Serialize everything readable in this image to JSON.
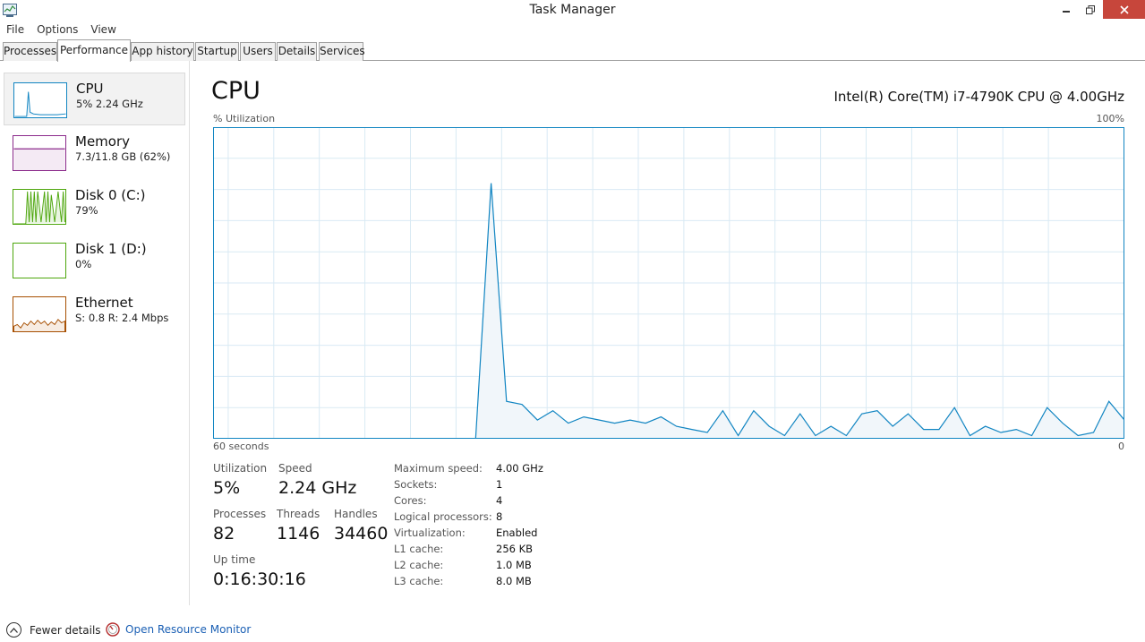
{
  "window": {
    "title": "Task Manager"
  },
  "menu": [
    "File",
    "Options",
    "View"
  ],
  "tabs": [
    "Processes",
    "Performance",
    "App history",
    "Startup",
    "Users",
    "Details",
    "Services"
  ],
  "sidebar": [
    {
      "name": "CPU",
      "sub": "5%  2.24 GHz",
      "color": "#1185c2"
    },
    {
      "name": "Memory",
      "sub": "7.3/11.8 GB (62%)",
      "color": "#8b2a8b"
    },
    {
      "name": "Disk 0 (C:)",
      "sub": "79%",
      "color": "#4da60c"
    },
    {
      "name": "Disk 1 (D:)",
      "sub": "0%",
      "color": "#4da60c"
    },
    {
      "name": "Ethernet",
      "sub": "S: 0.8  R: 2.4 Mbps",
      "color": "#a74f01"
    }
  ],
  "main": {
    "title": "CPU",
    "model": "Intel(R) Core(TM) i7-4790K CPU @ 4.00GHz",
    "graph_label": "% Utilization",
    "graph_max": "100%",
    "axis_left": "60 seconds",
    "axis_right": "0"
  },
  "stats": {
    "utilization_label": "Utilization",
    "utilization": "5%",
    "speed_label": "Speed",
    "speed": "2.24 GHz",
    "processes_label": "Processes",
    "processes": "82",
    "threads_label": "Threads",
    "threads": "1146",
    "handles_label": "Handles",
    "handles": "34460",
    "uptime_label": "Up time",
    "uptime": "0:16:30:16"
  },
  "specs": [
    {
      "label": "Maximum speed:",
      "value": "4.00 GHz"
    },
    {
      "label": "Sockets:",
      "value": "1"
    },
    {
      "label": "Cores:",
      "value": "4"
    },
    {
      "label": "Logical processors:",
      "value": "8"
    },
    {
      "label": "Virtualization:",
      "value": "Enabled"
    },
    {
      "label": "L1 cache:",
      "value": "256 KB"
    },
    {
      "label": "L2 cache:",
      "value": "1.0 MB"
    },
    {
      "label": "L3 cache:",
      "value": "8.0 MB"
    }
  ],
  "footer": {
    "fewer": "Fewer details",
    "resmon": "Open Resource Monitor"
  },
  "cpu_history_percent": [
    0,
    0,
    0,
    0,
    0,
    0,
    0,
    0,
    0,
    0,
    0,
    0,
    0,
    0,
    0,
    0,
    0,
    0,
    82,
    12,
    11,
    6,
    9,
    5,
    7,
    6,
    5,
    6,
    5,
    7,
    4,
    3,
    2,
    9,
    1,
    9,
    4,
    1,
    8,
    1,
    4,
    1,
    8,
    9,
    4,
    8,
    3,
    3,
    10,
    1,
    4,
    2,
    3,
    1,
    10,
    5,
    1,
    2,
    12,
    6
  ],
  "colors": {
    "cpu_line": "#1185c2",
    "cpu_fill": "#f1f6fa",
    "grid": "#d9eaf4",
    "graph_border": "#1185c2"
  }
}
